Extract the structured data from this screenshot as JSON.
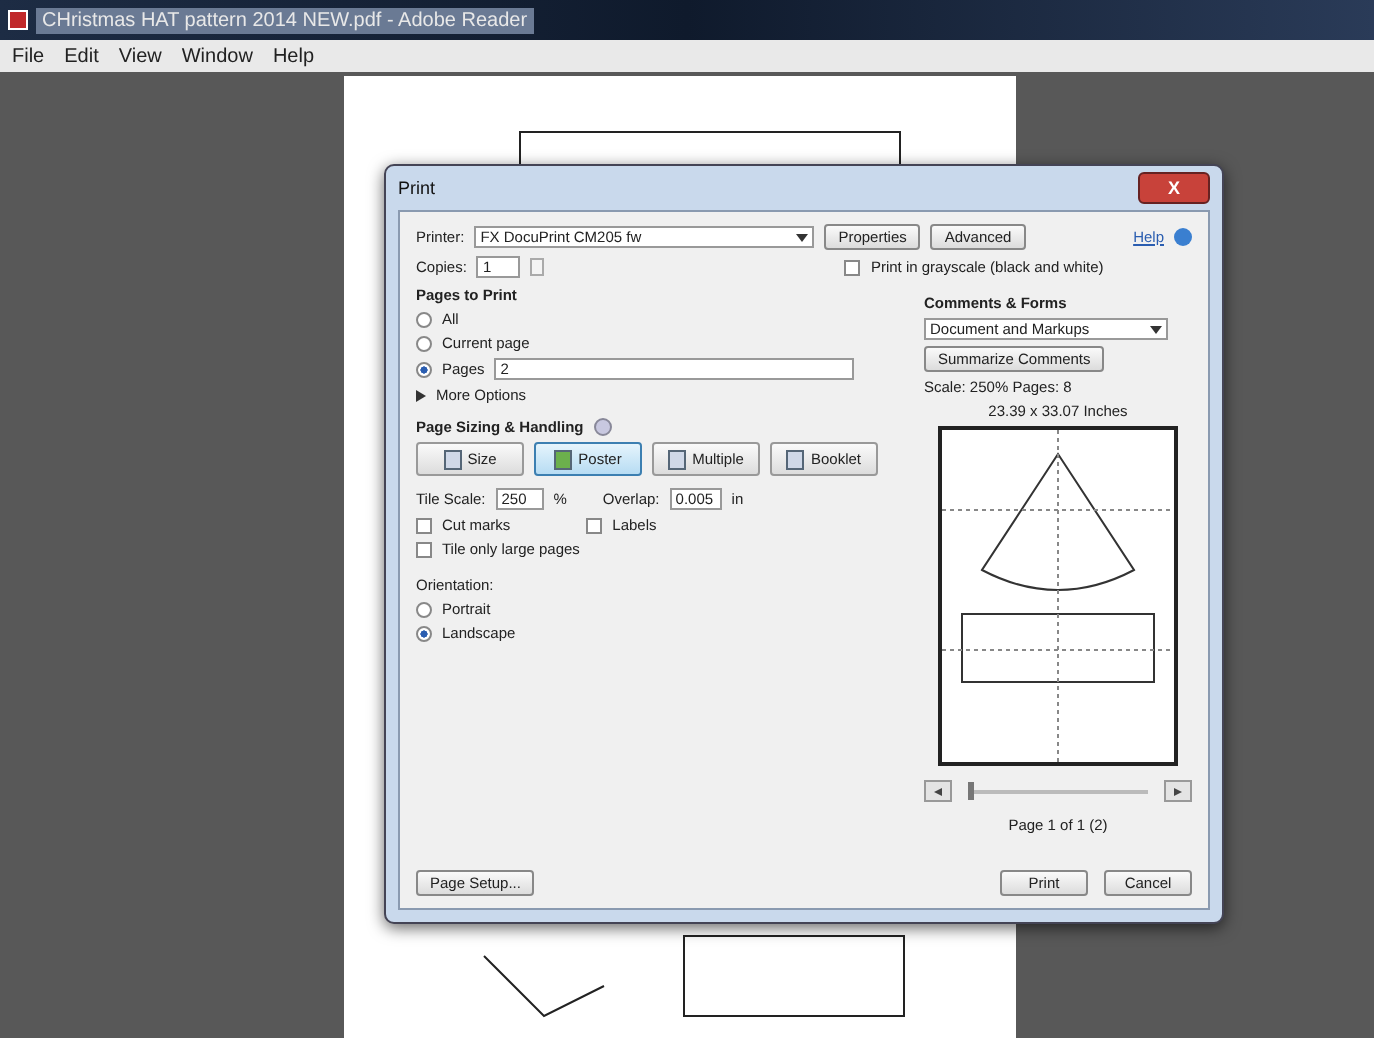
{
  "window": {
    "title": "CHristmas HAT pattern 2014 NEW.pdf - Adobe Reader"
  },
  "menu": [
    "File",
    "Edit",
    "View",
    "Window",
    "Help"
  ],
  "dialog": {
    "title": "Print",
    "close": "X",
    "printer": {
      "label": "Printer:",
      "value": "FX DocuPrint CM205 fw"
    },
    "printer_buttons": [
      "Properties",
      "Advanced"
    ],
    "help": "Help",
    "copies": {
      "label": "Copies:",
      "value": "1"
    },
    "grayscale": {
      "label": "Print in grayscale (black and white)",
      "checked": false
    },
    "pages_to_print": {
      "heading": "Pages to Print",
      "options": [
        {
          "label": "All",
          "selected": false
        },
        {
          "label": "Current page",
          "selected": false
        },
        {
          "label": "Pages",
          "selected": true,
          "value": "2"
        }
      ],
      "more_options": "More Options"
    },
    "page_sizing": {
      "heading": "Page Sizing & Handling",
      "modes": [
        {
          "label": "Size",
          "selected": false
        },
        {
          "label": "Poster",
          "selected": true
        },
        {
          "label": "Multiple",
          "selected": false
        },
        {
          "label": "Booklet",
          "selected": false
        }
      ],
      "tile_scale": {
        "label": "Tile Scale:",
        "value": "250",
        "unit": "%"
      },
      "overlap": {
        "label": "Overlap:",
        "value": "0.005",
        "unit": "in"
      },
      "checks": [
        {
          "label": "Cut marks",
          "checked": false
        },
        {
          "label": "Labels",
          "checked": false
        },
        {
          "label": "Tile only large pages",
          "checked": false
        }
      ]
    },
    "orientation": {
      "heading": "Orientation:",
      "options": [
        {
          "label": "Portrait",
          "selected": false
        },
        {
          "label": "Landscape",
          "selected": true
        }
      ]
    },
    "comments": {
      "heading": "Comments & Forms",
      "value": "Document and Markups",
      "summarize": "Summarize Comments"
    },
    "scale_info": "Scale: 250% Pages: 8",
    "size_info": "23.39 x 33.07 Inches",
    "slider": {
      "level": 0
    },
    "page_info": "Page 1 of 1 (2)",
    "page_setup": "Page Setup...",
    "actions": [
      "Print",
      "Cancel"
    ]
  }
}
